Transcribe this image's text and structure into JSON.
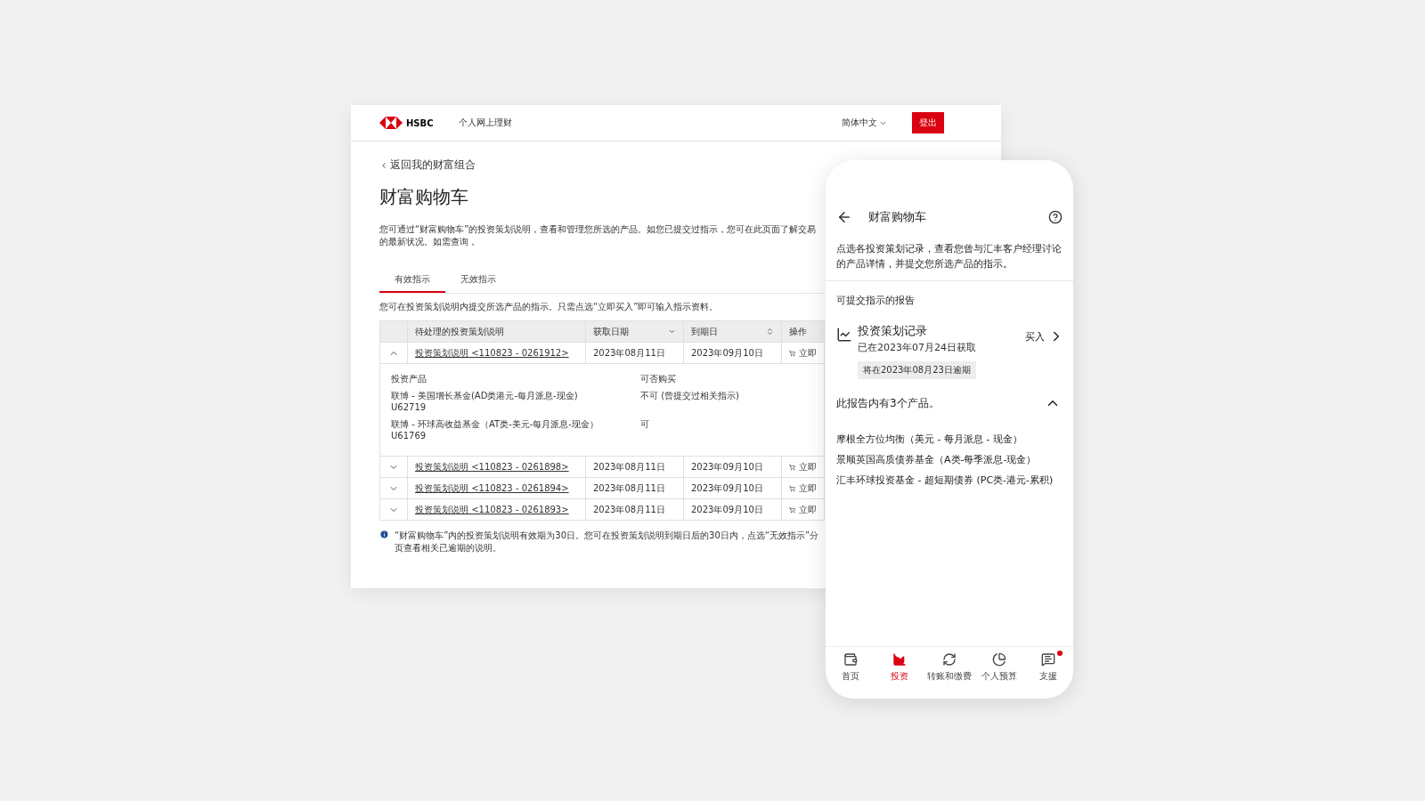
{
  "desktop": {
    "header": {
      "brand": "HSBC",
      "product": "个人网上理财",
      "language": "简体中文",
      "logout": "登出"
    },
    "back_link": "返回我的财富组合",
    "title": "财富购物车",
    "intro": "您可通过“财富购物车”的投资策划说明，查看和管理您所选的产品。如您已提交过指示，您可在此页面了解交易的最新状况。如需查询，",
    "tabs": [
      {
        "label": "有效指示",
        "selected": true
      },
      {
        "label": "无效指示",
        "selected": false
      }
    ],
    "tab_note": "您可在投资策划说明内提交所选产品的指示。只需点选“立即买入”即可输入指示资料。",
    "table": {
      "columns": [
        "待处理的投资策划说明",
        "获取日期",
        "到期日",
        "操作"
      ],
      "rows": [
        {
          "expanded": true,
          "link": "投资策划说明 <110823 - 0261912>",
          "obtained": "2023年08月11日",
          "expiry": "2023年09月10日",
          "action": "立即",
          "details": {
            "product_heading": "投资产品",
            "availability_heading": "可否购买",
            "products": [
              {
                "name": "联博 - 美国增长基金(AD类港元-每月派息-现金)",
                "code": "U62719",
                "availability": "不可 (曾提交过相关指示)"
              },
              {
                "name": "联博 - 环球高收益基金（AT类-美元-每月派息-现金）",
                "code": "U61769",
                "availability": "可"
              }
            ]
          }
        },
        {
          "expanded": false,
          "link": "投资策划说明 <110823 - 0261898>",
          "obtained": "2023年08月11日",
          "expiry": "2023年09月10日",
          "action": "立即"
        },
        {
          "expanded": false,
          "link": "投资策划说明 <110823 - 0261894>",
          "obtained": "2023年08月11日",
          "expiry": "2023年09月10日",
          "action": "立即"
        },
        {
          "expanded": false,
          "link": "投资策划说明 <110823 - 0261893>",
          "obtained": "2023年08月11日",
          "expiry": "2023年09月10日",
          "action": "立即"
        }
      ]
    },
    "footnote": "“财富购物车”内的投资策划说明有效期为30日。您可在投资策划说明到期日后的30日内，点选“无效指示”分页查看相关已逾期的说明。"
  },
  "phone": {
    "title": "财富购物车",
    "description": "点选各投资策划记录，查看您曾与汇丰客户经理讨论的产品详情，并提交您所选产品的指示。",
    "section": "可提交指示的报告",
    "record": {
      "title": "投资策划记录",
      "subtitle": "已在2023年07月24日获取",
      "action": "买入",
      "tag": "将在2023年08月23日逾期"
    },
    "products_header": {
      "label": "此报告内有3个产品。",
      "expanded": true
    },
    "products": [
      "摩根全方位均衡（美元 - 每月派息 - 现金）",
      "景顺英国高质债券基金（A类-每季派息-现金）",
      "汇丰环球投资基金 - 超短期债券 (PC类-港元-累积)"
    ],
    "nav": [
      {
        "kind": "home",
        "label": "首页",
        "selected": false,
        "notification": false
      },
      {
        "kind": "invest",
        "label": "投资",
        "selected": true,
        "notification": false
      },
      {
        "kind": "transfer",
        "label": "转账和缴费",
        "selected": false,
        "notification": false
      },
      {
        "kind": "budget",
        "label": "个人预算",
        "selected": false,
        "notification": false
      },
      {
        "kind": "support",
        "label": "支援",
        "selected": false,
        "notification": true
      }
    ]
  }
}
